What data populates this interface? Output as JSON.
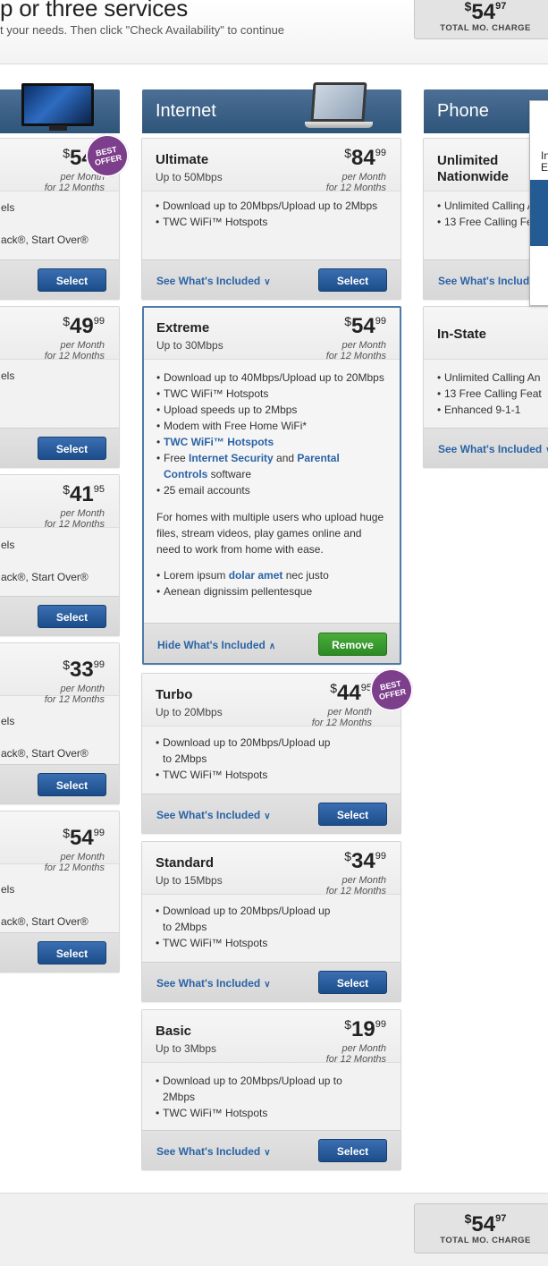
{
  "header": {
    "title": "p or three services",
    "subtitle": "t your needs. Then click \"Check Availability\" to continue"
  },
  "total": {
    "currency": "$",
    "whole": "54",
    "cents": "97",
    "label": "TOTAL MO. CHARGE"
  },
  "badge_text": "BEST OFFER",
  "tv_column": {
    "cards": [
      {
        "price_whole": "54",
        "price_cents": "99",
        "per": "per Month",
        "term": "for 12 Months",
        "line1": "els",
        "line2": "ack®, Start Over®",
        "button": "Select",
        "best_offer": true
      },
      {
        "price_whole": "49",
        "price_cents": "99",
        "per": "per Month",
        "term": "for 12 Months",
        "line1": "els",
        "line2": "",
        "button": "Select",
        "best_offer": false
      },
      {
        "price_whole": "41",
        "price_cents": "95",
        "per": "per Month",
        "term": "for 12 Months",
        "line1": "els",
        "line2": "ack®, Start Over®",
        "button": "Select",
        "best_offer": false
      },
      {
        "price_whole": "33",
        "price_cents": "99",
        "per": "per Month",
        "term": "for 12 Months",
        "line1": "els",
        "line2": "ack®, Start Over®",
        "button": "Select",
        "best_offer": false
      },
      {
        "price_whole": "54",
        "price_cents": "99",
        "per": "per Month",
        "term": "for 12 Months",
        "line1": "els",
        "line2": "ack®, Start Over®",
        "button": "Select",
        "best_offer": false
      }
    ]
  },
  "internet_column": {
    "heading": "Internet",
    "see_included": "See What's Included",
    "hide_included": "Hide What's Included",
    "cards": [
      {
        "name": "Ultimate",
        "speed": "Up to 50Mbps",
        "price_whole": "84",
        "price_cents": "99",
        "per": "per Month",
        "term": "for 12 Months",
        "features": [
          "Download up to 20Mbps/Upload up to 2Mbps",
          "TWC WiFi™ Hotspots"
        ],
        "button": "Select"
      },
      {
        "name": "Extreme",
        "speed": "Up to 30Mbps",
        "price_whole": "54",
        "price_cents": "99",
        "per": "per Month",
        "term": "for 12 Months",
        "features": [
          "Download up to 40Mbps/Upload up to 20Mbps",
          "TWC WiFi™ Hotspots",
          "Upload speeds up to 2Mbps",
          "Modem with Free Home WiFi*"
        ],
        "link_feature": "TWC WiFi™ Hotspots",
        "free_prefix": "Free ",
        "free_link1": "Internet Security",
        "free_and": " and ",
        "free_link2": "Parental",
        "free_link2b": "Controls",
        "free_suffix": " software",
        "email": "25 email accounts",
        "description": "For homes with multiple users who upload huge files, stream videos, play games online and need to work from home with ease.",
        "lorem_prefix": "Lorem ipsum ",
        "lorem_link": "dolar amet",
        "lorem_suffix": " nec justo",
        "extra": "Aenean dignissim pellentesque",
        "button": "Remove"
      },
      {
        "name": "Turbo",
        "speed": "Up to 20Mbps",
        "price_whole": "44",
        "price_cents": "95",
        "per": "per Month",
        "term": "for 12 Months",
        "features": [
          "Download up to 20Mbps/Upload up to 2Mbps",
          "TWC WiFi™ Hotspots"
        ],
        "button": "Select"
      },
      {
        "name": "Standard",
        "speed": "Up to 15Mbps",
        "price_whole": "34",
        "price_cents": "99",
        "per": "per Month",
        "term": "for 12 Months",
        "features": [
          "Download up to 20Mbps/Upload up to 2Mbps",
          "TWC WiFi™ Hotspots"
        ],
        "button": "Select"
      },
      {
        "name": "Basic",
        "speed": "Up to 3Mbps",
        "price_whole": "19",
        "price_cents": "99",
        "per": "per Month",
        "term": "for 12 Months",
        "features": [
          "Download up to 20Mbps/Upload up to 2Mbps",
          "TWC WiFi™ Hotspots"
        ],
        "button": "Select"
      }
    ]
  },
  "phone_column": {
    "heading": "Phone",
    "see_included": "See What's Includ",
    "see_included_2": "See What's Included",
    "cards": [
      {
        "name_line1": "Unlimited",
        "name_line2": "Nationwide",
        "features": [
          "Unlimited Calling A",
          "13 Free Calling Fe"
        ]
      },
      {
        "name_line1": "In-State",
        "features": [
          "Unlimited Calling An",
          "13 Free Calling Feat",
          "Enhanced 9-1-1"
        ]
      }
    ]
  },
  "popup": {
    "line1": "In",
    "line2": "E"
  }
}
